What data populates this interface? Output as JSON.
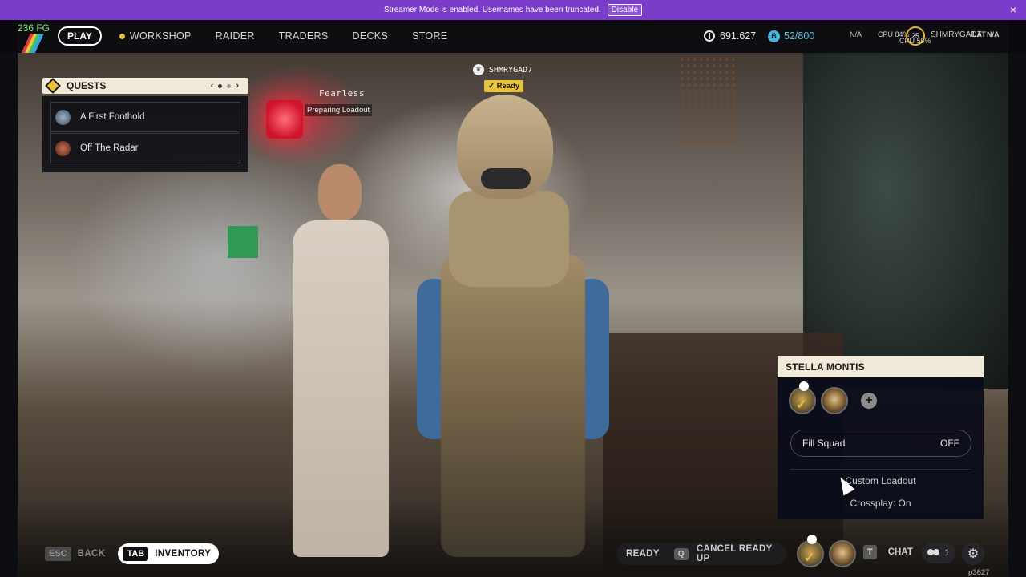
{
  "banner": {
    "text": "Streamer Mode is enabled. Usernames have been truncated.",
    "disable_label": "Disable",
    "close_icon": "×"
  },
  "hud": {
    "fps": "236 FG"
  },
  "nav": {
    "play_label": "PLAY",
    "items": [
      "WORKSHOP",
      "RAIDER",
      "TRADERS",
      "DECKS",
      "STORE"
    ]
  },
  "stats": {
    "coins": "691.627",
    "capacity": "52/800",
    "small_1": "N/A",
    "small_2": "CPU 84%",
    "small_3": "CPU 56%",
    "level": "25",
    "username": "SHMRYGAD7",
    "lat": "LAT",
    "lat_val": "N/A"
  },
  "quests": {
    "title": "QUESTS",
    "items": [
      {
        "label": "A First Foothold"
      },
      {
        "label": "Off The Radar"
      }
    ]
  },
  "players": {
    "fearless": "Fearless",
    "preparing": "Preparing Loadout",
    "name": "SHMRYGAD7",
    "ready": "✓ Ready"
  },
  "squad": {
    "title": "STELLA MONTIS",
    "fill_label": "Fill Squad",
    "fill_value": "OFF",
    "loadout": "Custom Loadout",
    "crossplay": "Crossplay: On"
  },
  "bottom": {
    "esc_key": "ESC",
    "back": "BACK",
    "tab_key": "TAB",
    "inventory": "INVENTORY",
    "ready": "READY",
    "q_key": "Q",
    "cancel": "CANCEL READY UP",
    "t_key": "T",
    "chat": "CHAT",
    "friends_count": "1",
    "build": "p3627"
  },
  "colors": {
    "banner": "#7b3cc9",
    "accent_gold": "#e8c23a",
    "panel_header": "#f1ead8",
    "fps_green": "#7ef07a"
  }
}
